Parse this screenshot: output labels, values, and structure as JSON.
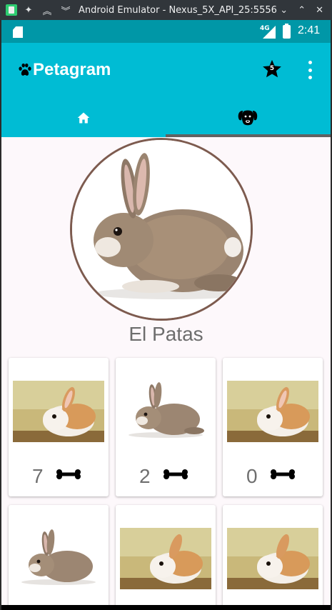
{
  "window": {
    "title": "Android Emulator - Nexus_5X_API_25:5556"
  },
  "status_bar": {
    "network": "4G",
    "time": "2:41"
  },
  "app_bar": {
    "title": "Petagram",
    "star_badge": "5"
  },
  "tabs": [
    {
      "icon": "home-icon",
      "selected": false
    },
    {
      "icon": "dog-icon",
      "selected": true
    }
  ],
  "profile": {
    "name": "El Patas"
  },
  "grid": [
    {
      "photo": "bunny-white",
      "likes": "7"
    },
    {
      "photo": "bunny-brown",
      "likes": "2"
    },
    {
      "photo": "bunny-white",
      "likes": "0"
    },
    {
      "photo": "bunny-brown",
      "likes": ""
    },
    {
      "photo": "bunny-white",
      "likes": ""
    },
    {
      "photo": "bunny-white",
      "likes": ""
    }
  ],
  "colors": {
    "primary": "#00bcd4",
    "primary_dark": "#0097a7",
    "profile_border": "#7d5b4f"
  }
}
